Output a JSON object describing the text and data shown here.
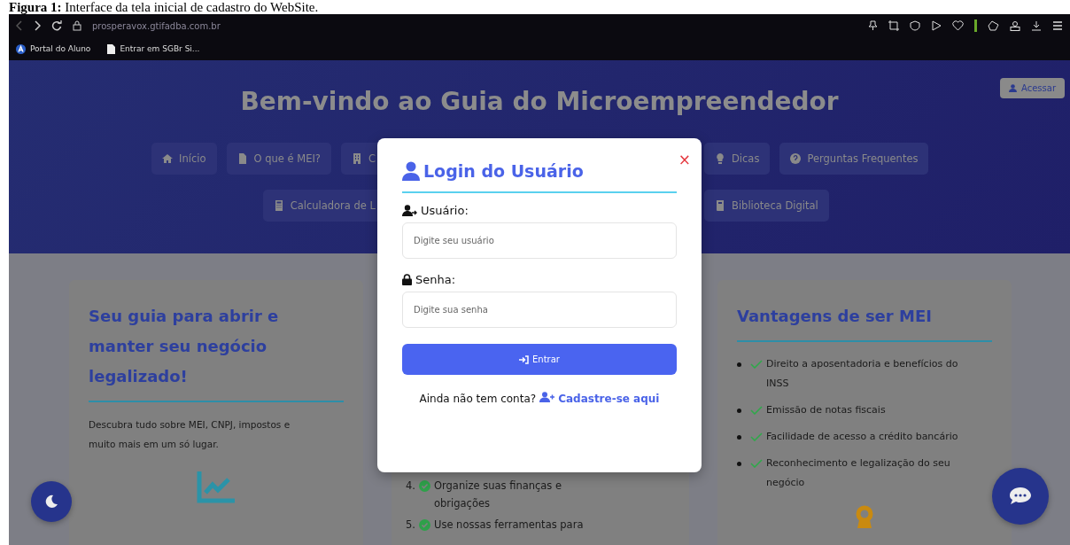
{
  "caption": "**Figura 1:** Interface da tela inicial de cadastro do WebSite.",
  "browser": {
    "url": "prosperavox.gtifadba.com.br",
    "bookmarks": [
      "Portal do Aluno",
      "Entrar em SGBr Si..."
    ]
  },
  "header": {
    "title": "Bem-vindo ao Guia do Microempreendedor",
    "login_button": "Acessar",
    "nav_rows": [
      {
        "left": [
          "Início",
          "O que é MEI?",
          "C"
        ],
        "right": [
          "Dicas",
          "Perguntas Frequentes"
        ]
      },
      {
        "left": [
          "Calculadora de L"
        ],
        "right": [
          "Biblioteca Digital"
        ]
      }
    ]
  },
  "cards": {
    "left": {
      "title": "Seu guia para abrir e manter seu negócio legalizado!",
      "text": "Descubra tudo sobre MEI, CNPJ, impostos e muito mais em um só lugar."
    },
    "middle": {
      "steps": [
        {
          "number": "4.",
          "text": "Organize suas finanças e obrigações"
        },
        {
          "number": "5.",
          "text": "Use nossas ferramentas para"
        }
      ]
    },
    "right": {
      "title": "Vantagens de ser MEI",
      "items": [
        "Direito a aposentadoria e benefícios do INSS",
        "Emissão de notas fiscais",
        "Facilidade de acesso a crédito bancário",
        "Reconhecimento e legalização do seu negócio"
      ]
    }
  },
  "modal": {
    "title": "Login do Usuário",
    "close": "×",
    "fields": [
      {
        "kind": "user",
        "label": "Usuário:",
        "placeholder": "Digite seu usuário"
      },
      {
        "kind": "password",
        "label": "Senha:",
        "placeholder": "Digite sua senha"
      }
    ],
    "submit": "Entrar",
    "prompt": "Ainda não tem conta?",
    "link": "Cadastre-se aqui"
  }
}
